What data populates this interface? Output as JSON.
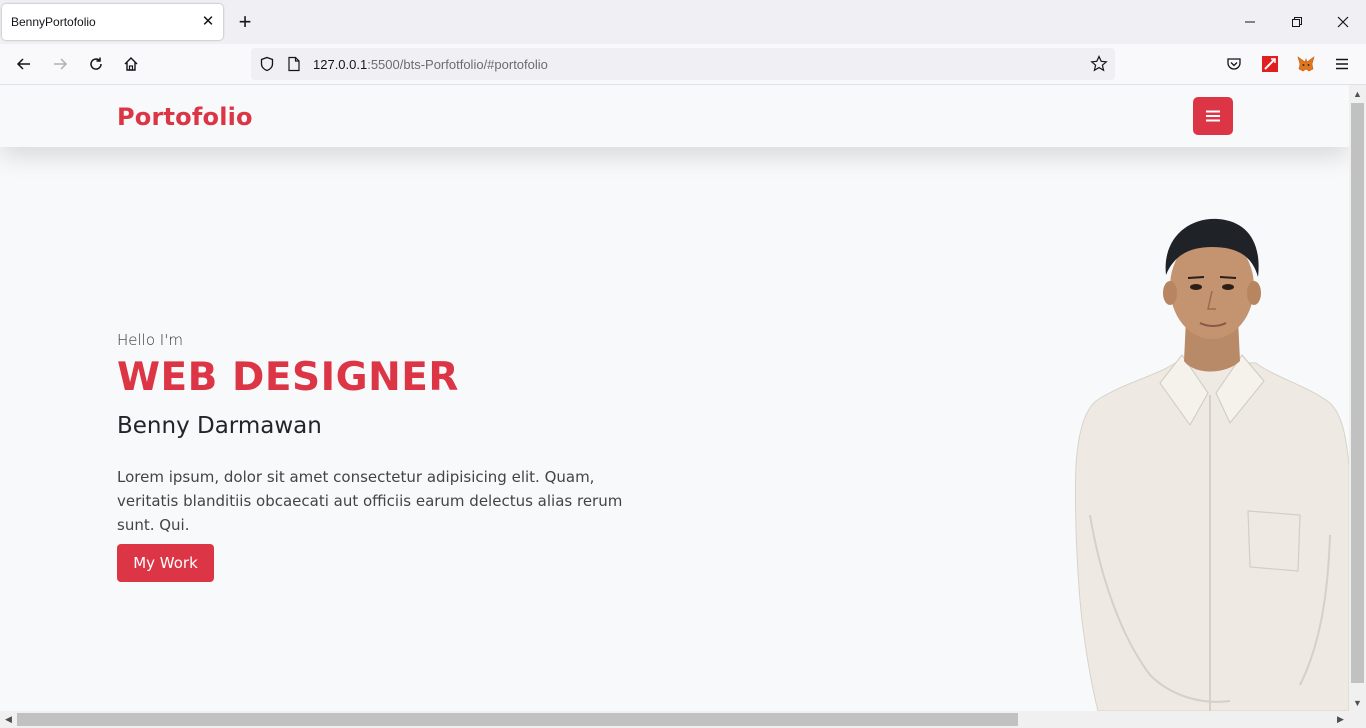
{
  "browser": {
    "tab_title": "BennyPortofolio",
    "url_host": "127.0.0.1",
    "url_rest": ":5500/bts-Porfotfolio/#portofolio",
    "icons": [
      "back-icon",
      "forward-icon",
      "reload-icon",
      "home-icon",
      "shield-icon",
      "page-icon",
      "bookmark-star-icon",
      "pocket-icon",
      "extension-icon",
      "metamask-icon",
      "menu-icon",
      "minimize-icon",
      "restore-icon",
      "close-icon"
    ]
  },
  "site": {
    "brand": "Portofolio",
    "accent_color": "#dc3545"
  },
  "hero": {
    "greeting": "Hello I'm",
    "role": "WEB DESIGNER",
    "name": "Benny Darmawan",
    "description": "Lorem ipsum, dolor sit amet consectetur adipisicing elit. Quam, veritatis blanditiis obcaecati aut officiis earum delectus alias rerum sunt. Qui.",
    "cta_label": "My Work"
  }
}
